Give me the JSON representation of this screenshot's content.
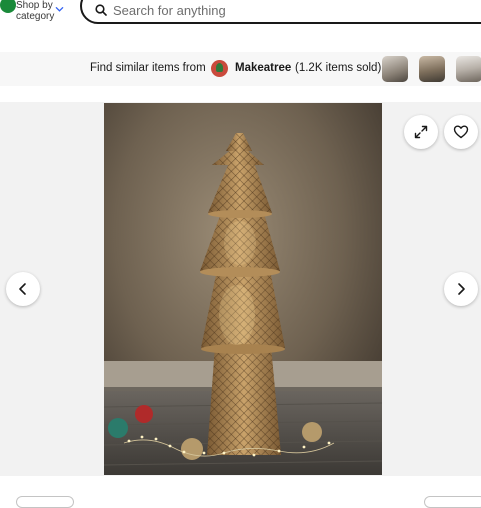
{
  "header": {
    "shop_by_label": "Shop by category",
    "search_placeholder": "Search for anything"
  },
  "similar": {
    "prefix": "Find similar items from",
    "seller_name": "Makeatree",
    "sold_text": "(1.2K items sold)"
  },
  "icons": {
    "shop": "chevron-down-icon",
    "search": "search-icon",
    "expand": "expand-icon",
    "heart": "heart-icon",
    "prev": "chevron-left-icon",
    "next": "chevron-right-icon"
  },
  "colors": {
    "accent": "#3665f3",
    "text": "#191919",
    "gallery_bg": "#f2f2f2"
  }
}
